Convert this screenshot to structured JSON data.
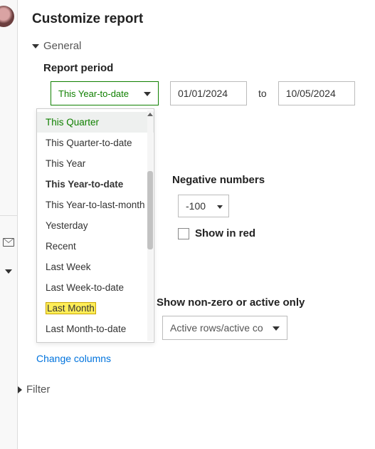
{
  "panel": {
    "title": "Customize report"
  },
  "sections": {
    "general": {
      "label": "General"
    },
    "filter": {
      "label": "Filter"
    }
  },
  "report_period": {
    "label": "Report period",
    "selected": "This Year-to-date",
    "from": "01/01/2024",
    "to_label": "to",
    "to": "10/05/2024",
    "options": [
      "This Quarter",
      "This Quarter-to-date",
      "This Year",
      "This Year-to-date",
      "This Year-to-last-month",
      "Yesterday",
      "Recent",
      "Last Week",
      "Last Week-to-date",
      "Last Month",
      "Last Month-to-date"
    ],
    "hovered_index": 0,
    "selected_index": 3,
    "highlighted_index": 9
  },
  "negative_numbers": {
    "label": "Negative numbers",
    "value": "-100",
    "show_in_red_label": "Show in red",
    "show_in_red_checked": false
  },
  "nonzero": {
    "label": "Show non-zero or active only",
    "value": "Active rows/active co"
  },
  "links": {
    "change_columns": "Change columns"
  }
}
